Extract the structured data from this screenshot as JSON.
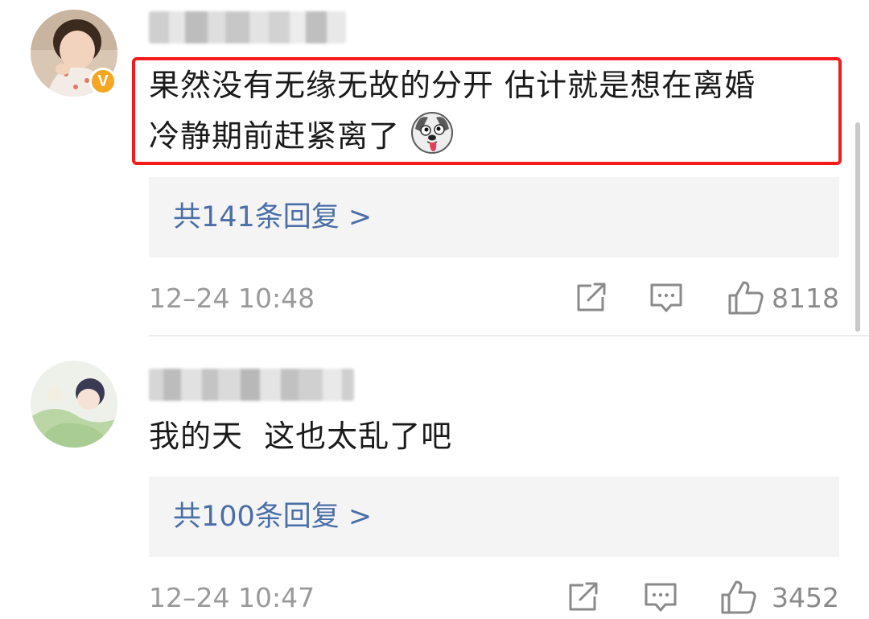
{
  "comments": [
    {
      "text_line1": "果然没有无缘无故的分开 估计就是想在离婚",
      "text_line2": "冷静期前赶紧离了",
      "emoji_icon": "husky-dog-tongue-emoji",
      "verified_badge": "V",
      "replies_label": "共141条回复 >",
      "timestamp": "12–24 10:48",
      "like_count": "8118"
    },
    {
      "text_line1": "我的天  这也太乱了吧",
      "replies_label": "共100条回复 >",
      "timestamp": "12–24 10:47",
      "like_count": "3452"
    }
  ],
  "colors": {
    "highlight_border": "#f51b1b",
    "reply_link": "#4a6ea8",
    "reply_bg": "#f4f4f4",
    "meta_text": "#9a9a9a",
    "verified_badge": "#f5a623"
  }
}
